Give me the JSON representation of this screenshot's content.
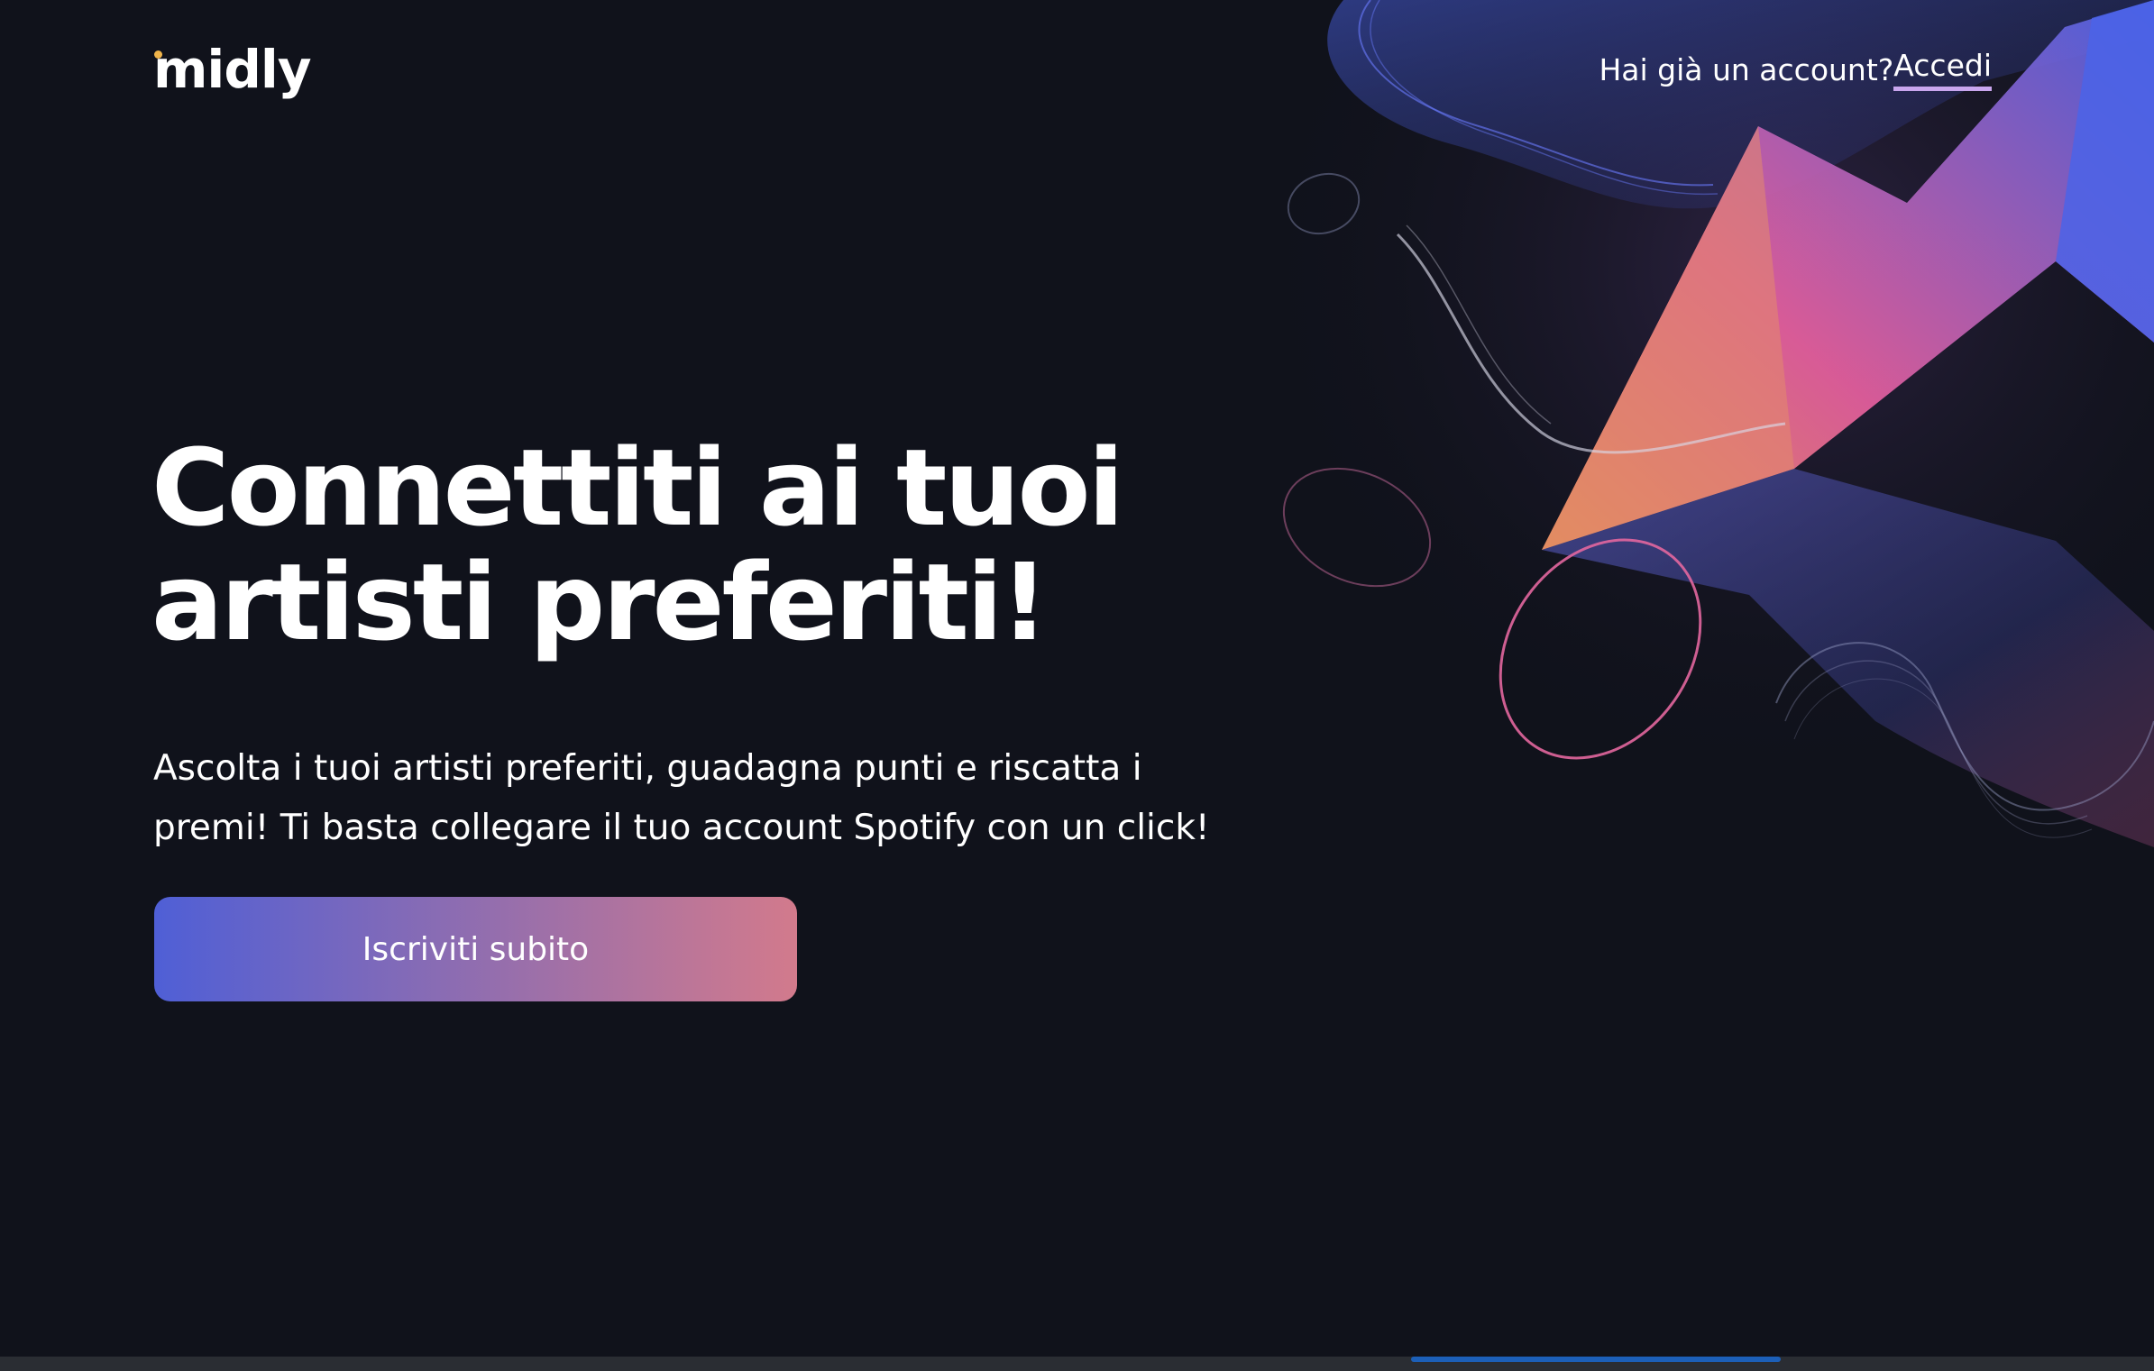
{
  "brand": {
    "logo_text": "midly",
    "dot_color": "#f0b44a"
  },
  "nav": {
    "question": "Hai già un account?",
    "login_label": "Accedi"
  },
  "hero": {
    "title_line1": "Connettiti ai tuoi",
    "title_line2": "artisti preferiti!",
    "subtitle_line1": "Ascolta i tuoi artisti preferiti, guadagna punti e riscatta i",
    "subtitle_line2": "premi! Ti basta collegare il tuo account Spotify con un click!",
    "cta_label": "Iscriviti subito"
  },
  "colors": {
    "background": "#10121b",
    "cta_gradient_start": "#4f5fd6",
    "cta_gradient_end": "#d27a8c",
    "link_underline": "#c9a6ee",
    "art_pink": "#e7609f",
    "art_blue": "#4b63e8"
  },
  "decoration": {
    "art": "abstract-waves-illustration"
  }
}
